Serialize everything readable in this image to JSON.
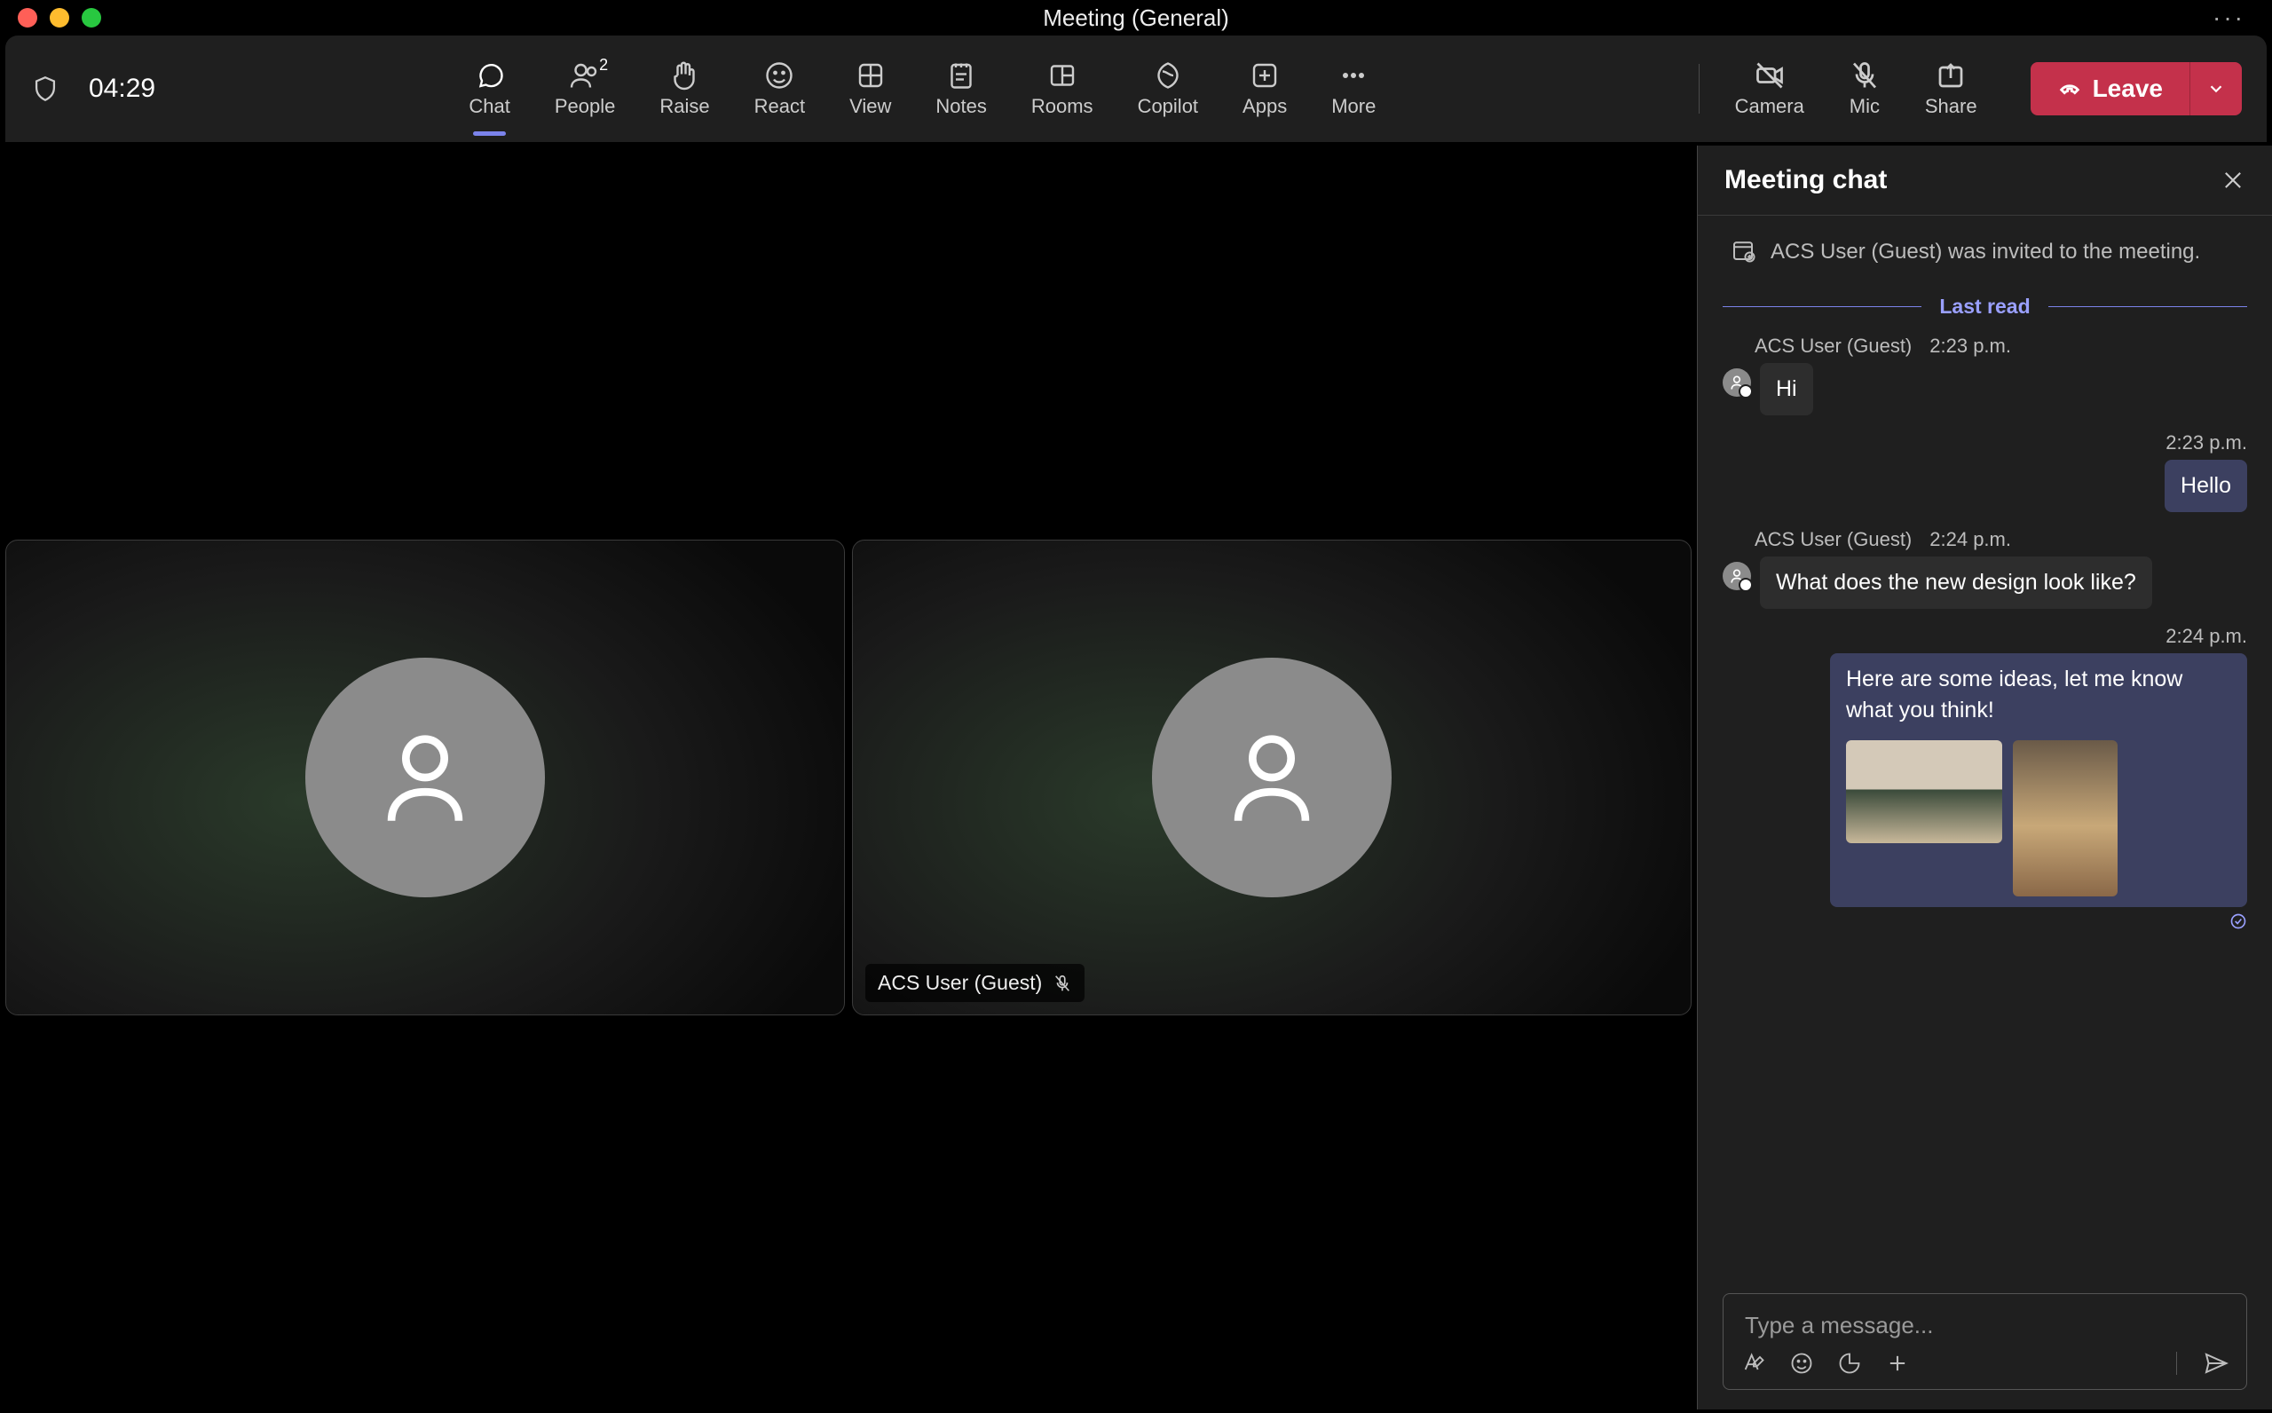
{
  "window": {
    "title": "Meeting (General)"
  },
  "header": {
    "timer": "04:29",
    "buttons": {
      "chat": "Chat",
      "people": "People",
      "people_count": "2",
      "raise": "Raise",
      "react": "React",
      "view": "View",
      "notes": "Notes",
      "rooms": "Rooms",
      "copilot": "Copilot",
      "apps": "Apps",
      "more": "More",
      "camera": "Camera",
      "mic": "Mic",
      "share": "Share",
      "leave": "Leave"
    }
  },
  "stage": {
    "tile2": {
      "name": "ACS User (Guest)"
    }
  },
  "chat": {
    "title": "Meeting chat",
    "system": "ACS User (Guest) was invited to the meeting.",
    "last_read": "Last read",
    "m1": {
      "sender": "ACS User (Guest)",
      "time": "2:23 p.m.",
      "text": "Hi"
    },
    "m2": {
      "time": "2:23 p.m.",
      "text": "Hello"
    },
    "m3": {
      "sender": "ACS User (Guest)",
      "time": "2:24 p.m.",
      "text": "What does the new design look like?"
    },
    "m4": {
      "time": "2:24 p.m.",
      "text": "Here are some ideas, let me know what you think!"
    },
    "compose_placeholder": "Type a message..."
  }
}
